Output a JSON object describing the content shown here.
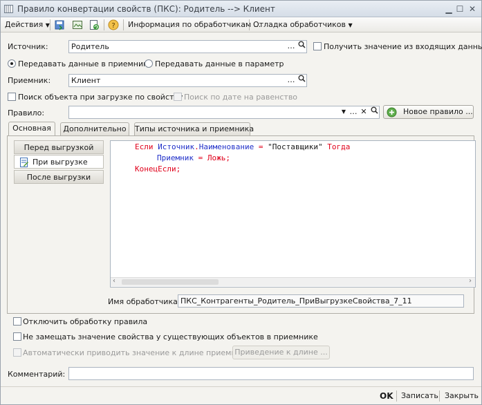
{
  "window": {
    "title": "Правило конвертации свойств (ПКС): Родитель --> Клиент"
  },
  "toolbar": {
    "actions_label": "Действия",
    "handlers_info_label": "Информация по обработчикам ...",
    "debug_label": "Отладка обработчиков"
  },
  "source": {
    "label": "Источник:",
    "value": "Родитель"
  },
  "get_from_input": {
    "label": "Получить значение из входящих данных"
  },
  "radio_receiver": {
    "label": "Передавать данные в приемник"
  },
  "radio_param": {
    "label": "Передавать данные в параметр"
  },
  "receiver": {
    "label": "Приемник:",
    "value": "Клиент"
  },
  "search_by_prop": {
    "label": "Поиск объекта при загрузке по свойству"
  },
  "search_by_date": {
    "label": "Поиск по дате на равенство"
  },
  "rule": {
    "label": "Правило:",
    "value": "",
    "new_rule_label": "Новое правило ..."
  },
  "tabs": [
    "Основная",
    "Дополнительно",
    "Типы источника и приемника"
  ],
  "handlers": [
    "Перед выгрузкой",
    "При выгрузке",
    "После выгрузки"
  ],
  "code": {
    "line1": {
      "kw1": "Если ",
      "id1": "Источник",
      "dot": ".",
      "id2": "Наименование",
      "eq": " = ",
      "str": "\"Поставщики\"",
      "kw2": " Тогда"
    },
    "line2": {
      "id1": "Приемник",
      "eq": " = ",
      "kw": "Ложь;"
    },
    "line3": {
      "kw": "КонецЕсли;"
    }
  },
  "handler_name": {
    "label": "Имя обработчика:",
    "value": "ПКС_Контрагенты_Родитель_ПриВыгрузкеСвойства_7_11"
  },
  "options": {
    "disable_rule": "Отключить обработку правила",
    "no_replace": "Не замещать значение свойства у существующих объектов в приемнике",
    "auto_length": "Автоматически приводить значение к длине приемника",
    "length_button": "Приведение к длине ..."
  },
  "comment": {
    "label": "Комментарий:",
    "value": ""
  },
  "footer": {
    "ok": "OK",
    "save": "Записать",
    "close": "Закрыть"
  },
  "colors": {
    "keyword": "#e0001a",
    "identifier": "#1f2fc8"
  }
}
